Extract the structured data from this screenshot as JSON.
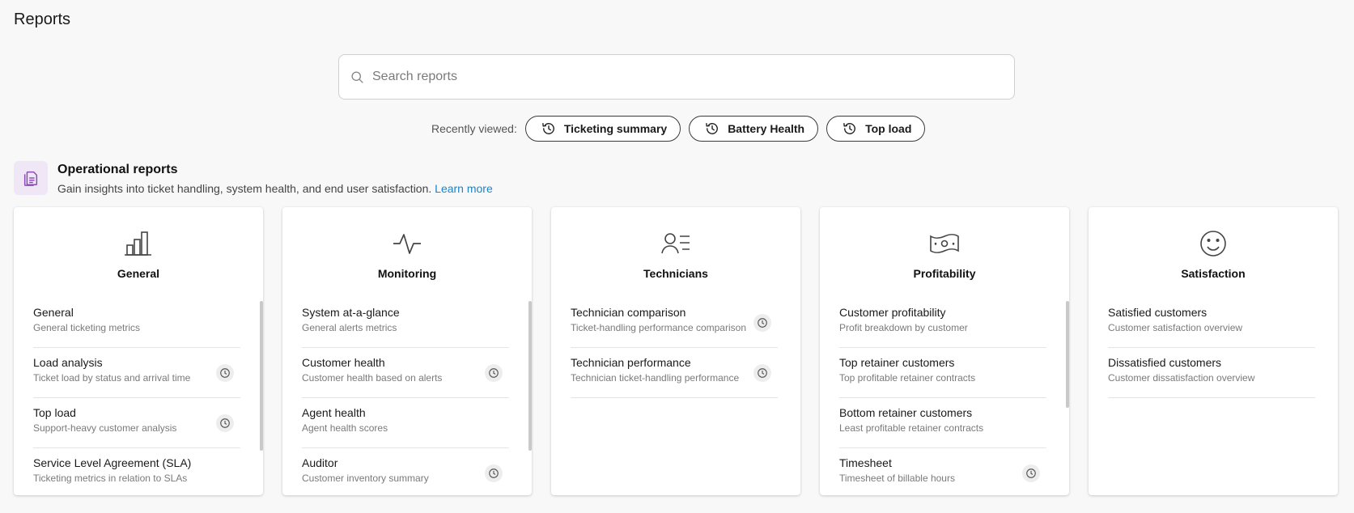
{
  "page": {
    "title": "Reports"
  },
  "search": {
    "placeholder": "Search reports"
  },
  "recent": {
    "label": "Recently viewed:",
    "items": [
      "Ticketing summary",
      "Battery Health",
      "Top load"
    ]
  },
  "section": {
    "title": "Operational reports",
    "description": "Gain insights into ticket handling, system health, and end user satisfaction.",
    "link": "Learn more"
  },
  "cards": [
    {
      "title": "General",
      "icon": "bar-chart-icon",
      "items": [
        {
          "title": "General",
          "desc": "General ticketing metrics",
          "recent": false
        },
        {
          "title": "Load analysis",
          "desc": "Ticket load by status and arrival time",
          "recent": true
        },
        {
          "title": "Top load",
          "desc": "Support-heavy customer analysis",
          "recent": true
        },
        {
          "title": "Service Level Agreement (SLA)",
          "desc": "Ticketing metrics in relation to SLAs",
          "recent": false
        }
      ]
    },
    {
      "title": "Monitoring",
      "icon": "pulse-icon",
      "items": [
        {
          "title": "System at-a-glance",
          "desc": "General alerts metrics",
          "recent": false
        },
        {
          "title": "Customer health",
          "desc": "Customer health based on alerts",
          "recent": true
        },
        {
          "title": "Agent health",
          "desc": "Agent health scores",
          "recent": false
        },
        {
          "title": "Auditor",
          "desc": "Customer inventory summary",
          "recent": true
        }
      ]
    },
    {
      "title": "Technicians",
      "icon": "user-list-icon",
      "items": [
        {
          "title": "Technician comparison",
          "desc": "Ticket-handling performance comparison",
          "recent": true
        },
        {
          "title": "Technician performance",
          "desc": "Technician ticket-handling performance",
          "recent": true
        }
      ]
    },
    {
      "title": "Profitability",
      "icon": "banknote-icon",
      "items": [
        {
          "title": "Customer profitability",
          "desc": "Profit breakdown by customer",
          "recent": false
        },
        {
          "title": "Top retainer customers",
          "desc": "Top profitable retainer contracts",
          "recent": false
        },
        {
          "title": "Bottom retainer customers",
          "desc": "Least profitable retainer contracts",
          "recent": false
        },
        {
          "title": "Timesheet",
          "desc": "Timesheet of billable hours",
          "recent": true
        }
      ]
    },
    {
      "title": "Satisfaction",
      "icon": "smiley-icon",
      "items": [
        {
          "title": "Satisfied customers",
          "desc": "Customer satisfaction overview",
          "recent": false
        },
        {
          "title": "Dissatisfied customers",
          "desc": "Customer dissatisfaction overview",
          "recent": false
        }
      ]
    }
  ]
}
